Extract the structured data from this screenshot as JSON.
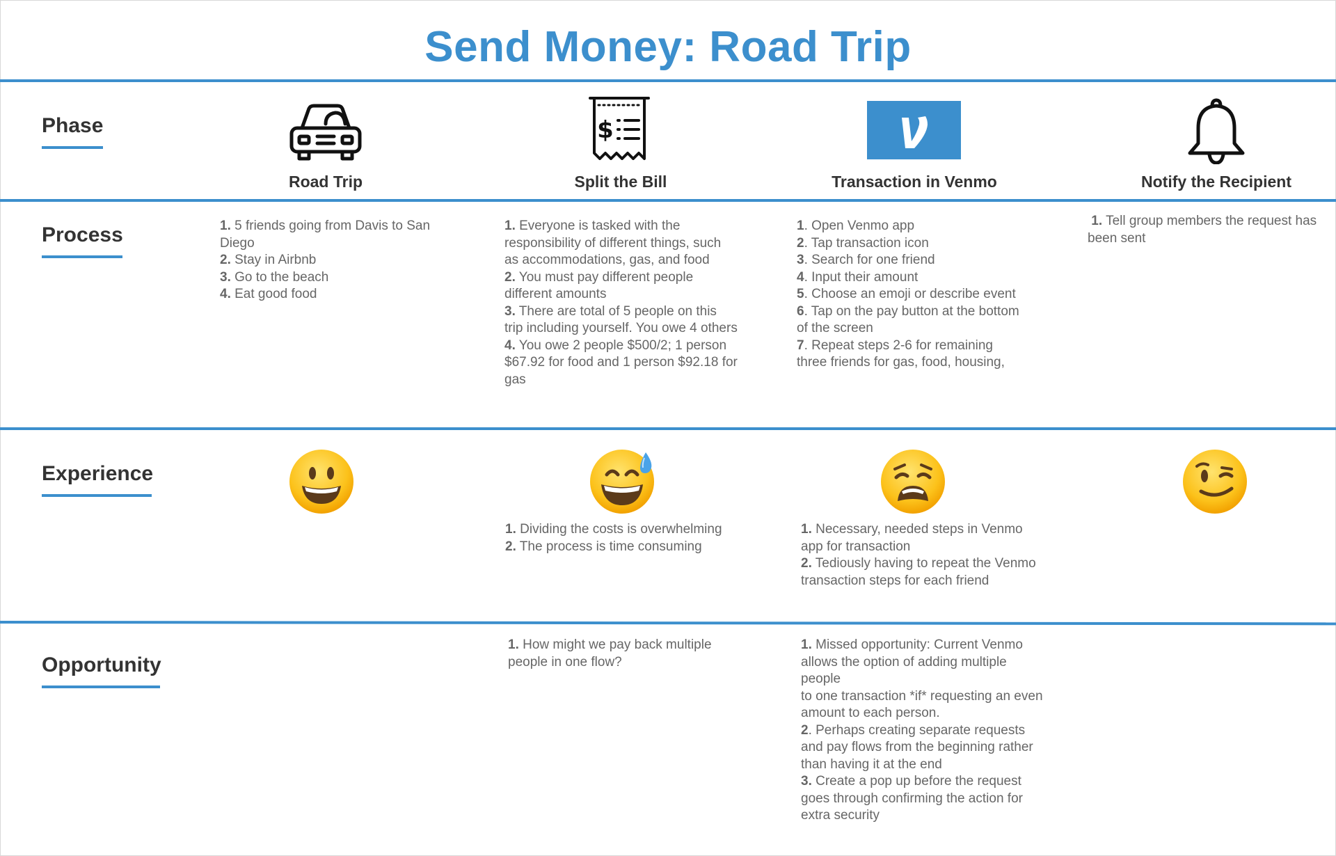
{
  "title": "Send Money: Road Trip",
  "colors": {
    "accent": "#3c8fcd",
    "label": "#333333",
    "body": "#666666"
  },
  "rows": {
    "phase": "Phase",
    "process": "Process",
    "experience": "Experience",
    "opportunity": "Opportunity"
  },
  "phases": [
    {
      "name": "Road Trip",
      "icon": "car-icon"
    },
    {
      "name": "Split the Bill",
      "icon": "receipt-icon"
    },
    {
      "name": "Transaction in Venmo",
      "icon": "venmo-logo-icon"
    },
    {
      "name": "Notify the Recipient",
      "icon": "bell-icon"
    }
  ],
  "process": [
    [
      {
        "n": "1.",
        "t": " 5 friends going from Davis to San Diego"
      },
      {
        "n": "2.",
        "t": " Stay in Airbnb"
      },
      {
        "n": "3.",
        "t": " Go to the beach"
      },
      {
        "n": "4.",
        "t": " Eat good food"
      }
    ],
    [
      {
        "n": "1.",
        "t": " Everyone is tasked with the responsibility of different things, such as accommodations, gas, and food"
      },
      {
        "n": "2.",
        "t": " You must pay different people different amounts"
      },
      {
        "n": "3.",
        "t": " There are total of 5 people on this trip including yourself. You owe 4 others"
      },
      {
        "n": "4.",
        "t": " You owe 2 people $500/2; 1 person $67.92 for food and 1 person $92.18 for gas"
      }
    ],
    [
      {
        "n": "1",
        "t": ". Open Venmo app"
      },
      {
        "n": "2",
        "t": ". Tap transaction icon"
      },
      {
        "n": "3",
        "t": ". Search for one friend"
      },
      {
        "n": "4",
        "t": ". Input their amount"
      },
      {
        "n": "5",
        "t": ". Choose an emoji or describe event"
      },
      {
        "n": "6",
        "t": ". Tap on the pay button at the bottom of the screen"
      },
      {
        "n": "7",
        "t": ". Repeat steps 2-6 for remaining three friends for gas, food, housing,"
      }
    ],
    [
      {
        "n": "1.",
        "t": " Tell group members the request has been sent"
      }
    ]
  ],
  "experience": [
    {
      "emoji": "grinning-face-icon",
      "notes": []
    },
    {
      "emoji": "sweat-smile-face-icon",
      "notes": [
        {
          "n": "1.",
          "t": " Dividing the costs is overwhelming"
        },
        {
          "n": "2.",
          "t": " The process is time consuming"
        }
      ]
    },
    {
      "emoji": "weary-face-icon",
      "notes": [
        {
          "n": "1.",
          "t": " Necessary, needed steps in Venmo app for transaction"
        },
        {
          "n": "2.",
          "t": " Tediously having to repeat the Venmo transaction steps for each friend"
        }
      ]
    },
    {
      "emoji": "winking-face-icon",
      "notes": []
    }
  ],
  "opportunity": [
    [],
    [
      {
        "n": "1.",
        "t": " How might we pay back multiple people in one flow?"
      }
    ],
    [
      {
        "n": "1.",
        "t": " Missed opportunity: Current Venmo allows the option of adding multiple people"
      },
      {
        "n": "",
        "t": "to one transaction *if* requesting an even amount to each person."
      },
      {
        "n": "2",
        "t": ". Perhaps creating separate requests and pay flows from the beginning rather than having it at the end"
      },
      {
        "n": "3.",
        "t": " Create a pop up before the request goes through confirming the action for extra security"
      }
    ],
    []
  ]
}
